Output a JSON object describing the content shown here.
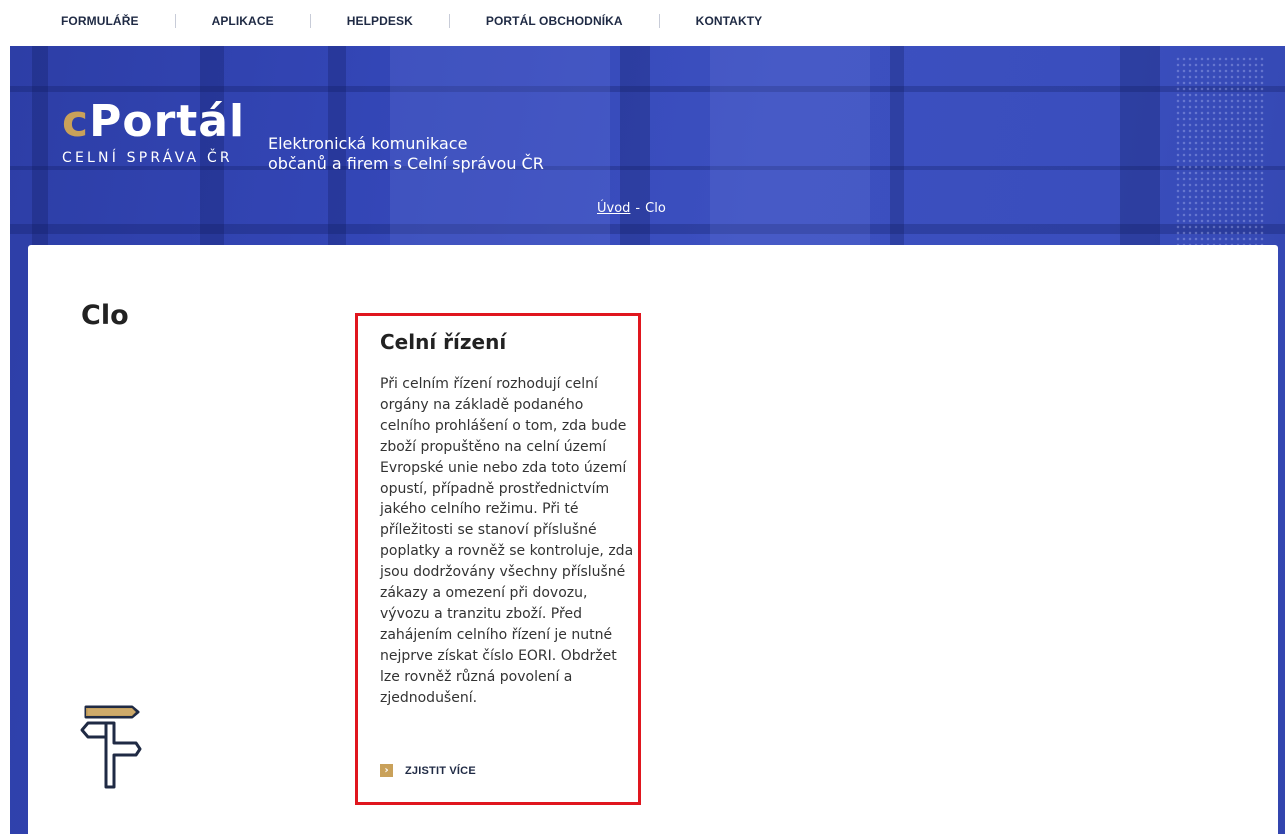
{
  "nav": {
    "items": [
      {
        "label": "FORMULÁŘE"
      },
      {
        "label": "APLIKACE"
      },
      {
        "label": "HELPDESK"
      },
      {
        "label": "PORTÁL OBCHODNÍKA"
      },
      {
        "label": "KONTAKTY"
      }
    ]
  },
  "logo": {
    "accent_letter": "c",
    "word": "Portál",
    "subtitle": "CELNÍ SPRÁVA ČR"
  },
  "tagline": {
    "line1": "Elektronická komunikace",
    "line2": "občanů a firem s Celní správou ČR"
  },
  "breadcrumb": {
    "home": "Úvod",
    "separator": "-",
    "current": "Clo"
  },
  "page": {
    "title": "Clo"
  },
  "card": {
    "title": "Celní řízení",
    "text": "Při celním řízení rozhodují celní orgány na základě podaného celního prohlášení o tom, zda bude zboží propuštěno na celní území Evropské unie nebo zda toto území opustí, případně prostřednictvím jakého celního režimu. Při té příležitosti se stanoví příslušné poplatky a rovněž se kontroluje, zda jsou dodržovány všechny příslušné zákazy a omezení při dovozu, vývozu a tranzitu zboží. Před zahájením celního řízení je nutné nejprve získat číslo EORI. Obdržet lze rovněž různá povolení a zjednodušení.",
    "more_label": "ZJISTIT VÍCE",
    "more_icon": "chevron-right-icon"
  },
  "colors": {
    "accent_gold": "#c9a15a",
    "hero_blue": "#3447b8",
    "highlight_red": "#e0161e",
    "nav_text": "#1f2a44"
  }
}
